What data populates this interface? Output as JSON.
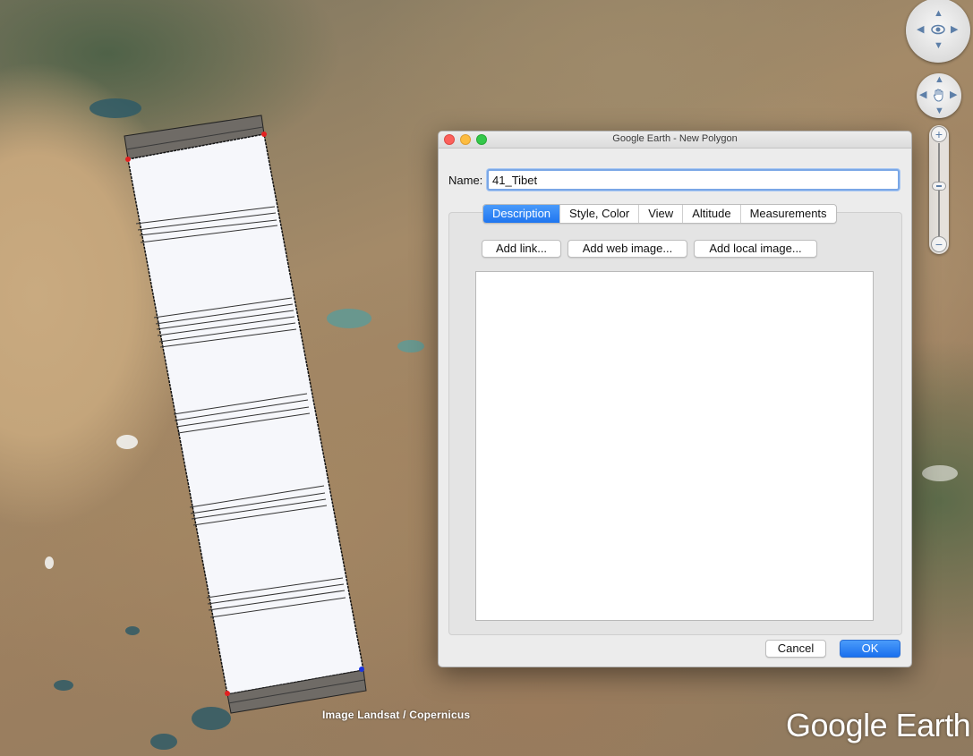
{
  "window": {
    "title": "Google Earth - New Polygon"
  },
  "form": {
    "name_label": "Name:",
    "name_value": "41_Tibet"
  },
  "tabs": [
    {
      "label": "Description",
      "active": true
    },
    {
      "label": "Style, Color",
      "active": false
    },
    {
      "label": "View",
      "active": false
    },
    {
      "label": "Altitude",
      "active": false
    },
    {
      "label": "Measurements",
      "active": false
    }
  ],
  "description": {
    "add_link_label": "Add link...",
    "add_web_image_label": "Add web image...",
    "add_local_image_label": "Add local image...",
    "text": ""
  },
  "footer": {
    "cancel_label": "Cancel",
    "ok_label": "OK"
  },
  "map": {
    "attribution": "Image Landsat / Copernicus",
    "logo_text": "Google Earth",
    "zoom_in_symbol": "+",
    "zoom_out_symbol": "−",
    "icons": {
      "look": "eye-icon",
      "move": "hand-icon"
    }
  },
  "colors": {
    "accent": "#1f75f0",
    "vertex_red": "#e32020",
    "vertex_blue": "#1a33e0",
    "polygon_fill": "#f6f7fb"
  }
}
